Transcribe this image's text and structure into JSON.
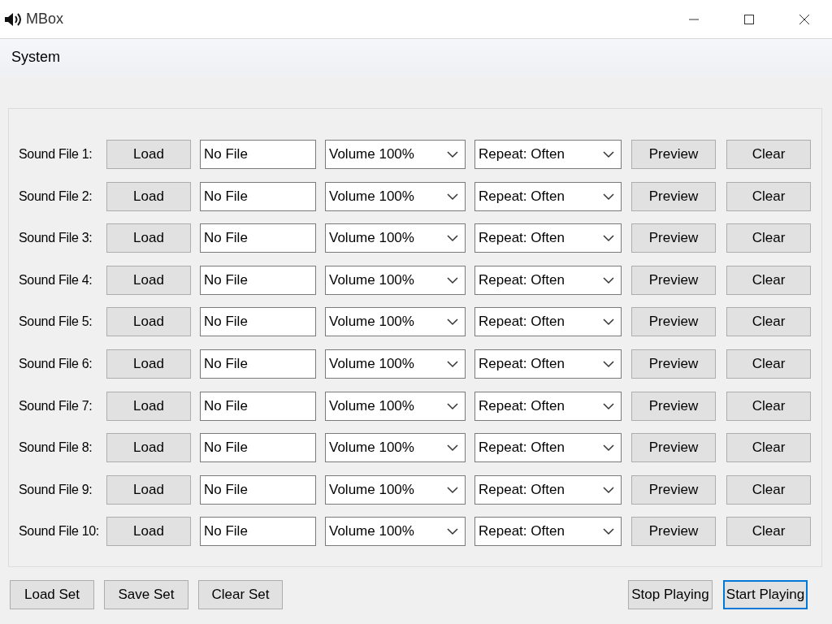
{
  "window": {
    "title": "MBox"
  },
  "menu": [
    "System"
  ],
  "rows": [
    {
      "label": "Sound File 1:",
      "load": "Load",
      "file": "No File",
      "volume": "Volume 100%",
      "repeat": "Repeat: Often",
      "preview": "Preview",
      "clear": "Clear"
    },
    {
      "label": "Sound File 2:",
      "load": "Load",
      "file": "No File",
      "volume": "Volume 100%",
      "repeat": "Repeat: Often",
      "preview": "Preview",
      "clear": "Clear"
    },
    {
      "label": "Sound File 3:",
      "load": "Load",
      "file": "No File",
      "volume": "Volume 100%",
      "repeat": "Repeat: Often",
      "preview": "Preview",
      "clear": "Clear"
    },
    {
      "label": "Sound File 4:",
      "load": "Load",
      "file": "No File",
      "volume": "Volume 100%",
      "repeat": "Repeat: Often",
      "preview": "Preview",
      "clear": "Clear"
    },
    {
      "label": "Sound File 5:",
      "load": "Load",
      "file": "No File",
      "volume": "Volume 100%",
      "repeat": "Repeat: Often",
      "preview": "Preview",
      "clear": "Clear"
    },
    {
      "label": "Sound File 6:",
      "load": "Load",
      "file": "No File",
      "volume": "Volume 100%",
      "repeat": "Repeat: Often",
      "preview": "Preview",
      "clear": "Clear"
    },
    {
      "label": "Sound File 7:",
      "load": "Load",
      "file": "No File",
      "volume": "Volume 100%",
      "repeat": "Repeat: Often",
      "preview": "Preview",
      "clear": "Clear"
    },
    {
      "label": "Sound File 8:",
      "load": "Load",
      "file": "No File",
      "volume": "Volume 100%",
      "repeat": "Repeat: Often",
      "preview": "Preview",
      "clear": "Clear"
    },
    {
      "label": "Sound File 9:",
      "load": "Load",
      "file": "No File",
      "volume": "Volume 100%",
      "repeat": "Repeat: Often",
      "preview": "Preview",
      "clear": "Clear"
    },
    {
      "label": "Sound File 10:",
      "load": "Load",
      "file": "No File",
      "volume": "Volume 100%",
      "repeat": "Repeat: Often",
      "preview": "Preview",
      "clear": "Clear"
    }
  ],
  "left_buttons": [
    {
      "label": "Load Set",
      "focused": false
    },
    {
      "label": "Save Set",
      "focused": false
    },
    {
      "label": "Clear Set",
      "focused": false
    }
  ],
  "right_buttons": [
    {
      "label": "Stop Playing",
      "focused": false
    },
    {
      "label": "Start Playing",
      "focused": true
    }
  ]
}
